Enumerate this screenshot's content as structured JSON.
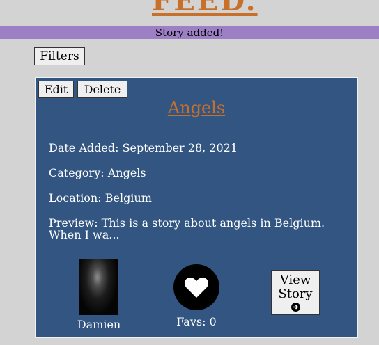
{
  "header": {
    "title": "FEED."
  },
  "alert": {
    "message": "Story added!"
  },
  "toolbar": {
    "filters_label": "Filters"
  },
  "story": {
    "edit_label": "Edit",
    "delete_label": "Delete",
    "title": "Angels",
    "date_added": "Date Added: September 28, 2021",
    "category": "Category: Angels",
    "location": "Location: Belgium",
    "preview": "Preview: This is a story about angels in Belgium. When I wa...",
    "author": "Damien",
    "favs": "Favs: 0",
    "view_label_line1": "View",
    "view_label_line2": "Story"
  },
  "colors": {
    "background": "#d3d3d3",
    "alert_bar": "#9c7fc4",
    "card": "#325582",
    "accent": "#c8702a"
  },
  "icons": [
    "heart-icon",
    "arrow-right-circle-icon"
  ]
}
